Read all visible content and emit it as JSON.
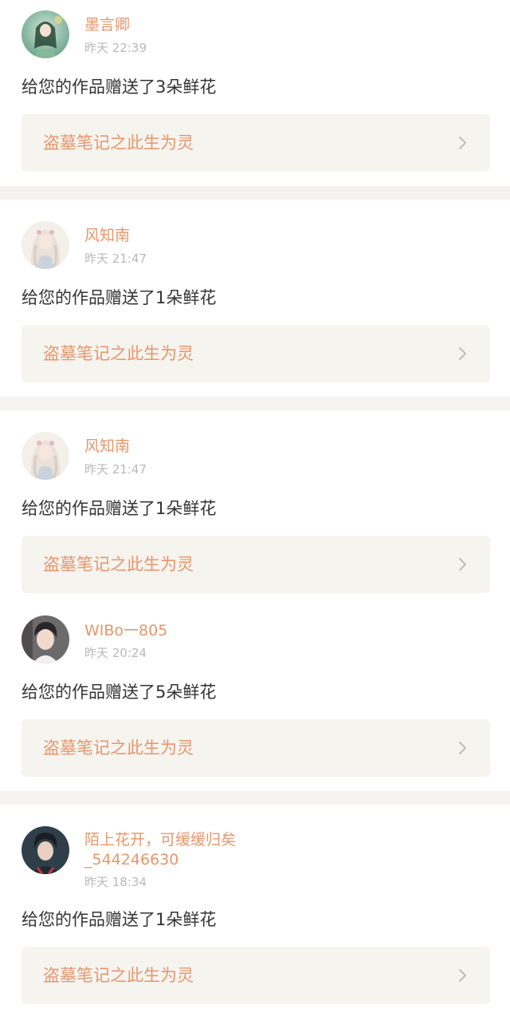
{
  "notifications": [
    {
      "username": "墨言卿",
      "time": "昨天 22:39",
      "message": "给您的作品赠送了3朵鲜花",
      "book_title": "盗墓笔记之此生为灵",
      "avatar_icon": "avatar-green-fairy"
    },
    {
      "username": "风知南",
      "time": "昨天 21:47",
      "message": "给您的作品赠送了1朵鲜花",
      "book_title": "盗墓笔记之此生为灵",
      "avatar_icon": "avatar-white-hair-girl"
    },
    {
      "username": "风知南",
      "time": "昨天 21:47",
      "message": "给您的作品赠送了1朵鲜花",
      "book_title": "盗墓笔记之此生为灵",
      "avatar_icon": "avatar-white-hair-girl"
    },
    {
      "username": "WIBo一805",
      "time": "昨天 20:24",
      "message": "给您的作品赠送了5朵鲜花",
      "book_title": "盗墓笔记之此生为灵",
      "avatar_icon": "avatar-young-man"
    },
    {
      "username_line1": "陌上花开，可缓缓归矣",
      "username_line2": "_544246630",
      "time": "昨天 18:34",
      "message": "给您的作品赠送了1朵鲜花",
      "book_title": "盗墓笔记之此生为灵",
      "avatar_icon": "avatar-young-man-dark"
    }
  ],
  "colors": {
    "accent": "#e9956a",
    "text": "#333333",
    "muted": "#b9b9b9",
    "link_bg": "#f5f4ef",
    "divider": "#f4f3f1"
  },
  "icons": {
    "chevron": "chevron-right-icon"
  }
}
